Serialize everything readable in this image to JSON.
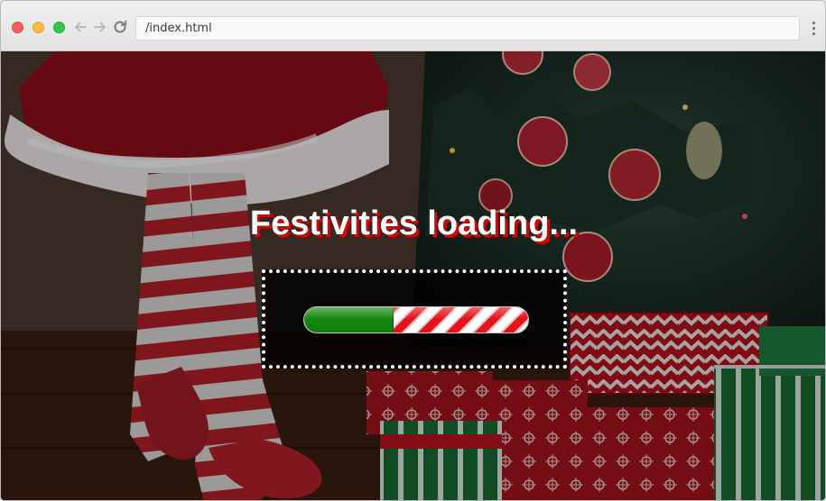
{
  "browser": {
    "address": "/index.html",
    "icons": {
      "back": "arrow-left-icon",
      "forward": "arrow-right-icon",
      "reload": "reload-icon",
      "menu": "more-vertical-icon"
    },
    "traffic_lights": {
      "close": "#fc605c",
      "minimize": "#fdbc40",
      "zoom": "#34c84a"
    }
  },
  "page": {
    "loading_title": "Festivities loading...",
    "progress": {
      "value": 0.4,
      "fill_color": "#128a0f",
      "stripe_colors": [
        "#ffffff",
        "#e3121b"
      ]
    }
  }
}
